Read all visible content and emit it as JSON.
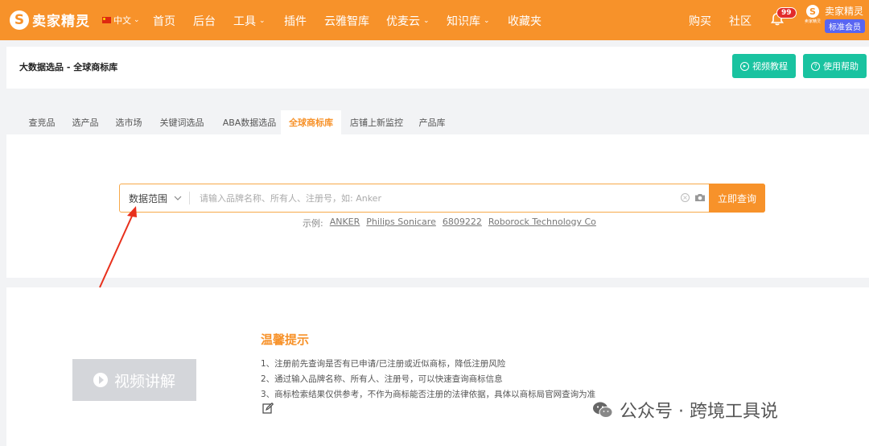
{
  "brand": {
    "name": "卖家精灵"
  },
  "lang": {
    "label": "中文"
  },
  "nav": [
    {
      "label": "首页",
      "dropdown": false
    },
    {
      "label": "后台",
      "dropdown": false
    },
    {
      "label": "工具",
      "dropdown": true
    },
    {
      "label": "插件",
      "dropdown": false
    },
    {
      "label": "云雅智库",
      "dropdown": false
    },
    {
      "label": "优麦云",
      "dropdown": true
    },
    {
      "label": "知识库",
      "dropdown": true
    },
    {
      "label": "收藏夹",
      "dropdown": false
    }
  ],
  "right_nav": {
    "buy": "购买",
    "community": "社区"
  },
  "notifications": {
    "count": "99"
  },
  "user": {
    "name": "卖家精灵",
    "member_level": "标准会员",
    "logo_caption": "卖家精灵"
  },
  "breadcrumb": "大数据选品 - 全球商标库",
  "header_buttons": {
    "video_tutorial": "视频教程",
    "help": "使用帮助"
  },
  "tabs": [
    {
      "label": "查竞品",
      "active": false
    },
    {
      "label": "选产品",
      "active": false
    },
    {
      "label": "选市场",
      "active": false
    },
    {
      "label": "关键词选品",
      "active": false
    },
    {
      "label": "ABA数据选品",
      "active": false
    },
    {
      "label": "全球商标库",
      "active": true
    },
    {
      "label": "店铺上新监控",
      "active": false
    },
    {
      "label": "产品库",
      "active": false
    }
  ],
  "search": {
    "scope_label": "数据范围",
    "placeholder": "请输入品牌名称、所有人、注册号，如: Anker",
    "value": "",
    "button_label": "立即查询"
  },
  "examples": {
    "label": "示例:",
    "items": [
      "ANKER",
      "Philips Sonicare",
      "6809222",
      "Roborock Technology Co"
    ]
  },
  "video": {
    "label": "视频讲解"
  },
  "tips": {
    "title": "温馨提示",
    "items": [
      "1、注册前先查询是否有已申请/已注册或近似商标，降低注册风险",
      "2、通过输入品牌名称、所有人、注册号，可以快速查询商标信息",
      "3、商标检索结果仅供参考，不作为商标能否注册的法律依据，具体以商标局官网查询为准"
    ]
  },
  "watermark": {
    "text": "公众号 · 跨境工具说"
  },
  "colors": {
    "brand_orange": "#f7922a",
    "green": "#19c3a0",
    "member_purple": "#5865f2",
    "arrow_red": "#e8301c"
  }
}
